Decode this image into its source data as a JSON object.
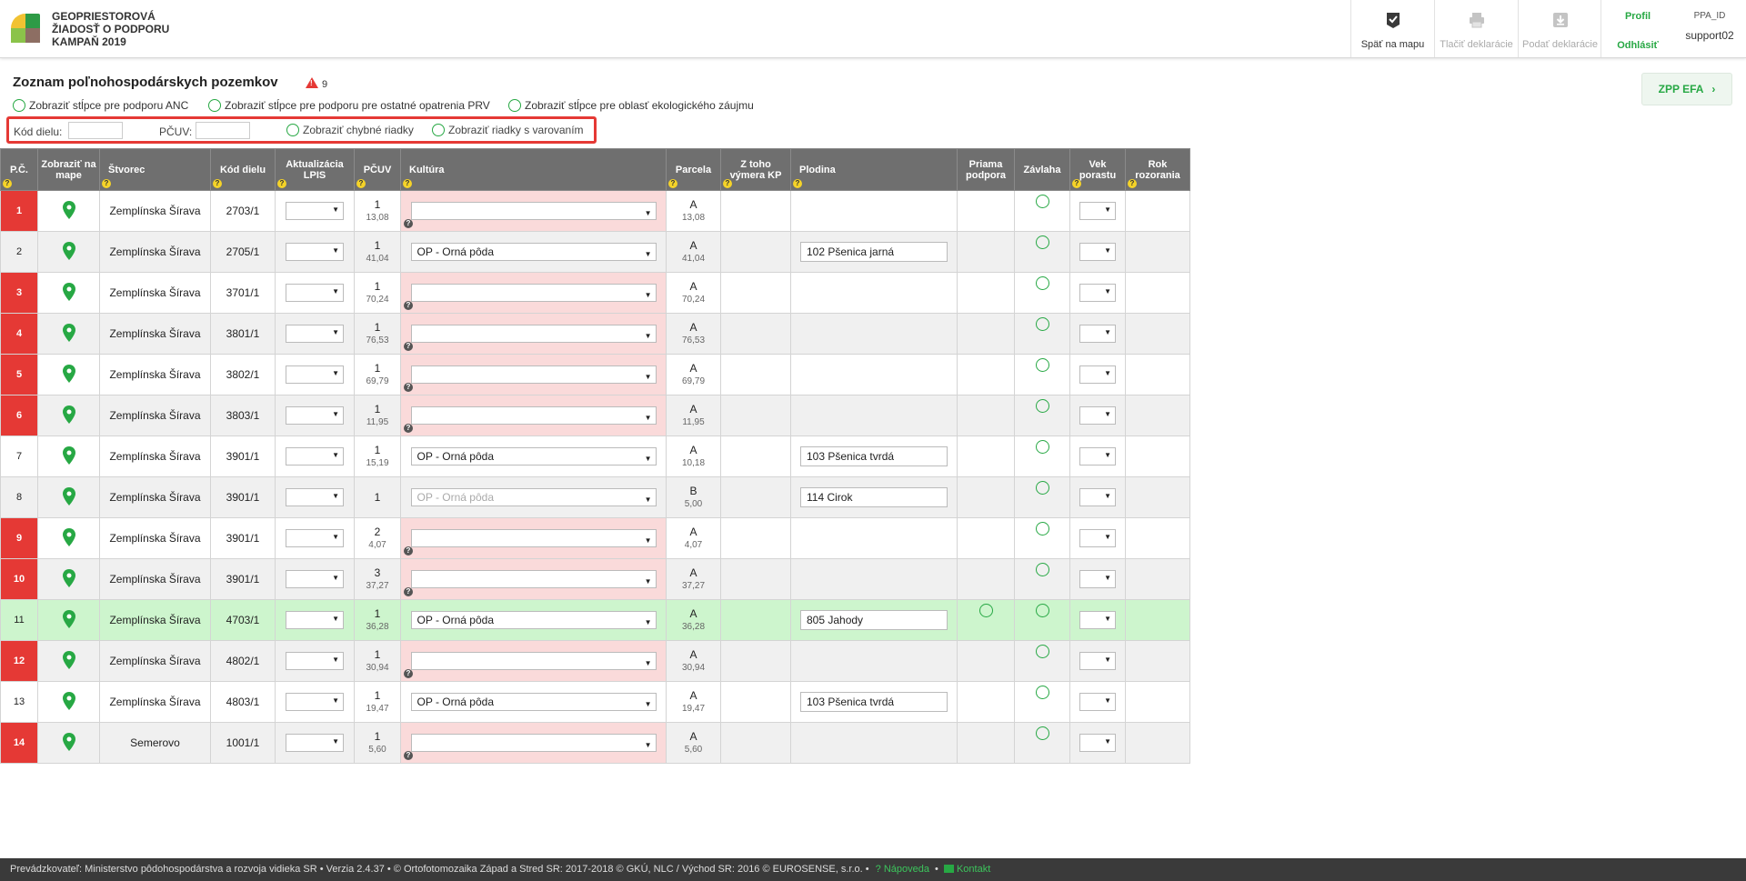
{
  "header": {
    "title_lines": [
      "GEOPRIESTOROVÁ",
      "ŽIADOSŤ O PODPORU",
      "KAMPAŇ 2019"
    ],
    "back_to_map": "Späť na mapu",
    "print_declarations": "Tlačiť deklarácie",
    "submit_declarations": "Podať deklarácie",
    "profile": "Profil",
    "logout": "Odhlásiť",
    "user_label": "PPA_ID",
    "user_name": "support02"
  },
  "page": {
    "title": "Zoznam poľnohospodárskych pozemkov",
    "warning_count": "9",
    "zpp_efa_button": "ZPP EFA",
    "radio_anc": "Zobraziť stĺpce pre podporu ANC",
    "radio_prv": "Zobraziť stĺpce pre podporu pre ostatné opatrenia PRV",
    "radio_efa": "Zobraziť stĺpce pre oblasť ekologického záujmu",
    "filter_kod_dielu": "Kód dielu:",
    "filter_pcuv": "PČUV:",
    "filter_errors": "Zobraziť chybné riadky",
    "filter_warnings": "Zobraziť riadky s varovaním"
  },
  "table": {
    "headers": {
      "pc": "P.Č.",
      "map": "Zobraziť na mape",
      "stvorec": "Štvorec",
      "kod": "Kód dielu",
      "lpis": "Aktualizácia LPIS",
      "pcuv": "PČUV",
      "kultura": "Kultúra",
      "parcela": "Parcela",
      "ztoho": "Z toho výmera KP",
      "plodina": "Plodina",
      "priama": "Priama podpora",
      "zavlaha": "Závlaha",
      "vek": "Vek porastu",
      "rok": "Rok rozorania"
    },
    "rows": [
      {
        "pc": "1",
        "err": true,
        "stvorec": "Zemplínska Šírava",
        "kod": "2703/1",
        "pcuv_top": "1",
        "pcuv_bot": "13,08",
        "kultura": "",
        "parc_top": "A",
        "parc_bot": "13,08",
        "plodina": "",
        "priama": false
      },
      {
        "pc": "2",
        "err": false,
        "stvorec": "Zemplínska Šírava",
        "kod": "2705/1",
        "pcuv_top": "1",
        "pcuv_bot": "41,04",
        "kultura": "OP - Orná pôda",
        "parc_top": "A",
        "parc_bot": "41,04",
        "plodina": "102  Pšenica jarná",
        "priama": false
      },
      {
        "pc": "3",
        "err": true,
        "stvorec": "Zemplínska Šírava",
        "kod": "3701/1",
        "pcuv_top": "1",
        "pcuv_bot": "70,24",
        "kultura": "",
        "parc_top": "A",
        "parc_bot": "70,24",
        "plodina": "",
        "priama": false
      },
      {
        "pc": "4",
        "err": true,
        "stvorec": "Zemplínska Šírava",
        "kod": "3801/1",
        "pcuv_top": "1",
        "pcuv_bot": "76,53",
        "kultura": "",
        "parc_top": "A",
        "parc_bot": "76,53",
        "plodina": "",
        "priama": false
      },
      {
        "pc": "5",
        "err": true,
        "stvorec": "Zemplínska Šírava",
        "kod": "3802/1",
        "pcuv_top": "1",
        "pcuv_bot": "69,79",
        "kultura": "",
        "parc_top": "A",
        "parc_bot": "69,79",
        "plodina": "",
        "priama": false
      },
      {
        "pc": "6",
        "err": true,
        "stvorec": "Zemplínska Šírava",
        "kod": "3803/1",
        "pcuv_top": "1",
        "pcuv_bot": "11,95",
        "kultura": "",
        "parc_top": "A",
        "parc_bot": "11,95",
        "plodina": "",
        "priama": false
      },
      {
        "pc": "7",
        "err": false,
        "stvorec": "Zemplínska Šírava",
        "kod": "3901/1",
        "pcuv_top": "1",
        "pcuv_bot": "15,19",
        "kultura": "OP - Orná pôda",
        "parc_top": "A",
        "parc_bot": "10,18",
        "plodina": "103  Pšenica tvrdá",
        "priama": false
      },
      {
        "pc": "8",
        "err": false,
        "stvorec": "Zemplínska Šírava",
        "kod": "3901/1",
        "pcuv_top": "1",
        "pcuv_bot": "",
        "kultura": "OP - Orná pôda",
        "kultura_disabled": true,
        "parc_top": "B",
        "parc_bot": "5,00",
        "plodina": "114  Cirok",
        "priama": false
      },
      {
        "pc": "9",
        "err": true,
        "stvorec": "Zemplínska Šírava",
        "kod": "3901/1",
        "pcuv_top": "2",
        "pcuv_bot": "4,07",
        "kultura": "",
        "parc_top": "A",
        "parc_bot": "4,07",
        "plodina": "",
        "priama": false
      },
      {
        "pc": "10",
        "err": true,
        "stvorec": "Zemplínska Šírava",
        "kod": "3901/1",
        "pcuv_top": "3",
        "pcuv_bot": "37,27",
        "kultura": "",
        "parc_top": "A",
        "parc_bot": "37,27",
        "plodina": "",
        "priama": false
      },
      {
        "pc": "11",
        "err": false,
        "hl": true,
        "stvorec": "Zemplínska Šírava",
        "kod": "4703/1",
        "pcuv_top": "1",
        "pcuv_bot": "36,28",
        "kultura": "OP - Orná pôda",
        "parc_top": "A",
        "parc_bot": "36,28",
        "plodina": "805  Jahody",
        "priama": true
      },
      {
        "pc": "12",
        "err": true,
        "stvorec": "Zemplínska Šírava",
        "kod": "4802/1",
        "pcuv_top": "1",
        "pcuv_bot": "30,94",
        "kultura": "",
        "parc_top": "A",
        "parc_bot": "30,94",
        "plodina": "",
        "priama": false
      },
      {
        "pc": "13",
        "err": false,
        "stvorec": "Zemplínska Šírava",
        "kod": "4803/1",
        "pcuv_top": "1",
        "pcuv_bot": "19,47",
        "kultura": "OP - Orná pôda",
        "parc_top": "A",
        "parc_bot": "19,47",
        "plodina": "103  Pšenica tvrdá",
        "priama": false
      },
      {
        "pc": "14",
        "err": true,
        "stvorec": "Semerovo",
        "kod": "1001/1",
        "pcuv_top": "1",
        "pcuv_bot": "5,60",
        "kultura": "",
        "parc_top": "A",
        "parc_bot": "5,60",
        "plodina": "",
        "priama": false
      }
    ]
  },
  "footer": {
    "text": "Prevádzkovateľ: Ministerstvo pôdohospodárstva a rozvoja vidieka SR • Verzia 2.4.37 • © Ortofotomozaika Západ a Stred SR: 2017-2018 © GKÚ, NLC / Východ SR: 2016 © EUROSENSE, s.r.o.  •",
    "help": "Nápoveda",
    "sep": "•",
    "contact": "Kontakt"
  },
  "colors": {
    "accent_green": "#27a844",
    "error_red": "#e53935",
    "header_gray": "#6f6f6f",
    "highlight_green": "#cdf5cd",
    "kultura_error_pink": "#fadada"
  },
  "icons": {
    "back_to_map": "checkmark-shield-icon",
    "print": "printer-icon",
    "submit": "download-icon",
    "map_pin": "map-pin-icon",
    "help": "question-icon",
    "warning": "warning-triangle-icon",
    "contact": "envelope-icon"
  }
}
